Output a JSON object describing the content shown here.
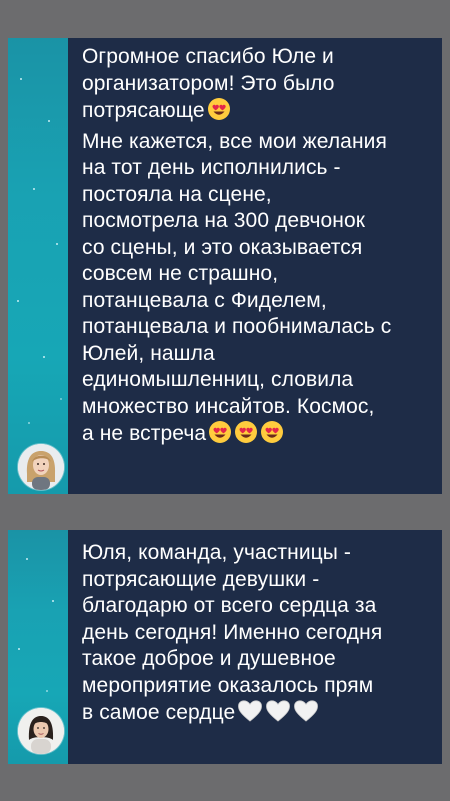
{
  "messages": [
    {
      "text": "Огромное спасибо Юле и\nорганизатором! Это было\nпотрясающе",
      "text_continued": "Мне кажется, все мои желания\nна тот день исполнились -\nпостояла на сцене,\nпосмотрела на 300 девчонок\nсо сцены, и это оказывается\nсовсем не страшно,\nпотанцевала с Фиделем,\nпотанцевала и пообнималась с\nЮлей, нашла\nединомышленниц, словила\nмножество инсайтов. Космос,\nа не встреча",
      "emoji_inline": "heart-eyes-emoji",
      "emoji_end": [
        "heart-eyes-emoji",
        "heart-eyes-emoji",
        "heart-eyes-emoji"
      ],
      "avatar": "avatar-blonde-woman"
    },
    {
      "text": "Юля, команда, участницы -\nпотрясающие девушки -\nблагодарю от всего сердца за\nдень сегодня! Именно сегодня\nтакое доброе и душевное\nмероприятие оказалось прям\nв самое сердце",
      "emoji_end": [
        "white-heart-emoji",
        "white-heart-emoji",
        "white-heart-emoji"
      ],
      "avatar": "avatar-dark-hair-woman"
    }
  ],
  "colors": {
    "background": "#6c6c6e",
    "card": "#1e2c47",
    "gutter": "#17a7b6",
    "text": "#ffffff"
  }
}
